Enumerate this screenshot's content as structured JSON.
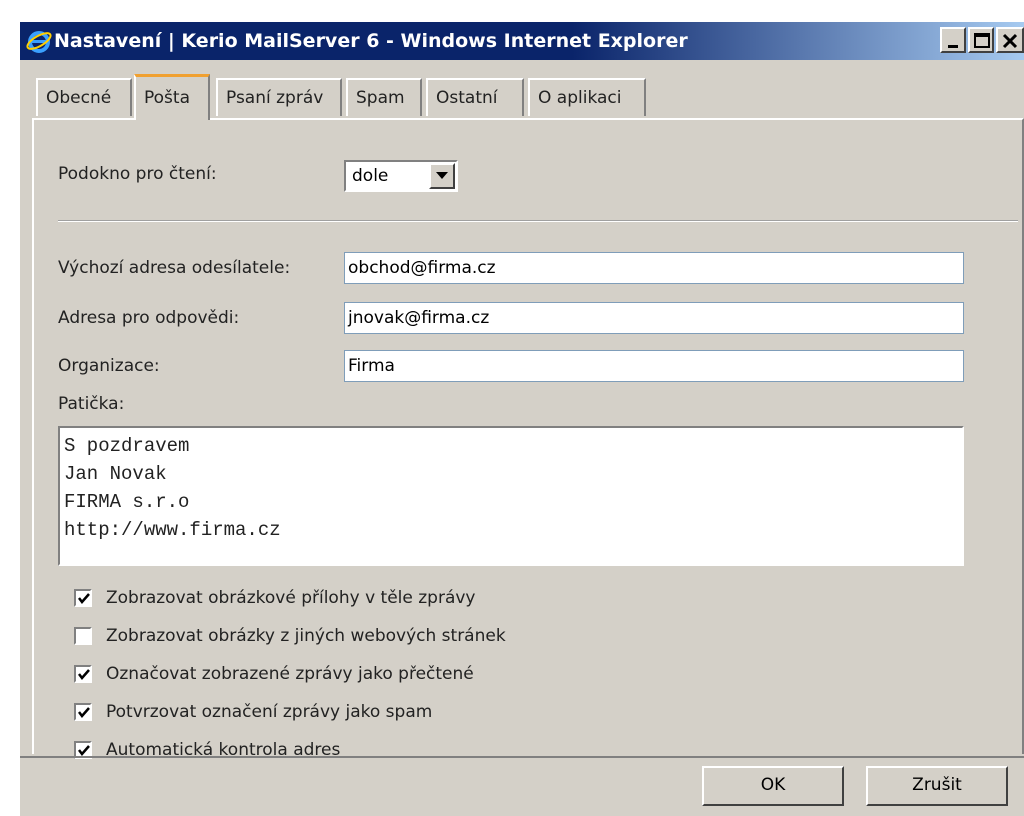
{
  "window": {
    "title": "Nastavení | Kerio MailServer 6 - Windows Internet Explorer"
  },
  "tabs": [
    {
      "label": "Obecné",
      "active": false
    },
    {
      "label": "Pošta",
      "active": true
    },
    {
      "label": "Psaní zpráv",
      "active": false
    },
    {
      "label": "Spam",
      "active": false
    },
    {
      "label": "Ostatní",
      "active": false
    },
    {
      "label": "O aplikaci",
      "active": false
    }
  ],
  "reading_pane": {
    "label": "Podokno pro čtení:",
    "value": "dole"
  },
  "fields": {
    "sender": {
      "label": "Výchozí adresa odesílatele:",
      "value": "obchod@firma.cz"
    },
    "reply_to": {
      "label": "Adresa pro odpovědi:",
      "value": "jnovak@firma.cz"
    },
    "organization": {
      "label": "Organizace:",
      "value": "Firma"
    }
  },
  "signature": {
    "label": "Patička:",
    "lines": [
      "S pozdravem",
      "Jan Novak",
      "FIRMA s.r.o",
      "http://www.firma.cz"
    ]
  },
  "options": [
    {
      "label": "Zobrazovat obrázkové přílohy v těle zprávy",
      "checked": true
    },
    {
      "label": "Zobrazovat obrázky z jiných webových stránek",
      "checked": false
    },
    {
      "label": "Označovat zobrazené zprávy jako přečtené",
      "checked": true
    },
    {
      "label": "Potvrzovat označení zprávy jako spam",
      "checked": true
    },
    {
      "label": "Automatická kontrola adres",
      "checked": true
    }
  ],
  "buttons": {
    "ok": "OK",
    "cancel": "Zrušit"
  },
  "colors": {
    "titlebar": "#0a246a",
    "dialog_bg": "#d4d0c8",
    "active_tab_accent": "#f0a030"
  }
}
